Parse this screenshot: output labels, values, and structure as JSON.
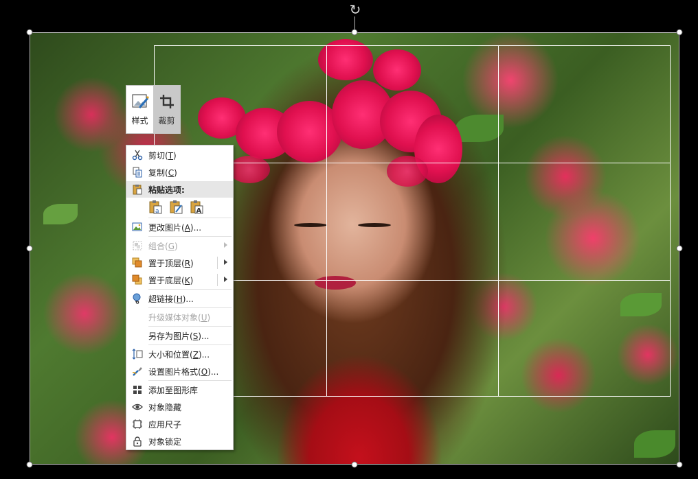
{
  "mini_toolbar": {
    "style_label": "样式",
    "crop_label": "裁剪"
  },
  "context_menu": {
    "cut": {
      "label": "剪切",
      "key": "T"
    },
    "copy": {
      "label": "复制",
      "key": "C"
    },
    "paste_options_label": "粘贴选项:",
    "paste_options": [
      "use-destination-theme",
      "keep-source-formatting",
      "keep-text-only"
    ],
    "change_picture": {
      "label": "更改图片",
      "key": "A",
      "suffix": "..."
    },
    "group": {
      "label": "组合",
      "key": "G"
    },
    "bring_to_front": {
      "label": "置于顶层",
      "key": "R"
    },
    "send_to_back": {
      "label": "置于底层",
      "key": "K"
    },
    "hyperlink": {
      "label": "超链接",
      "key": "H",
      "suffix": "..."
    },
    "upgrade_media": {
      "label": "升级媒体对象",
      "key": "U"
    },
    "save_as_picture": {
      "label": "另存为图片",
      "key": "S",
      "suffix": "..."
    },
    "size_position": {
      "label": "大小和位置",
      "key": "Z",
      "suffix": "..."
    },
    "format_picture": {
      "label": "设置图片格式",
      "key": "O",
      "suffix": "..."
    },
    "add_to_gallery": {
      "label": "添加至图形库"
    },
    "hide_object": {
      "label": "对象隐藏"
    },
    "apply_size": {
      "label": "应用尺子"
    },
    "lock_object": {
      "label": "对象锁定"
    }
  },
  "colors": {
    "menu_bg": "#ffffff",
    "menu_hover": "#e6e6e6",
    "disabled_text": "#a6a6a6",
    "canvas_bg": "#000000"
  }
}
